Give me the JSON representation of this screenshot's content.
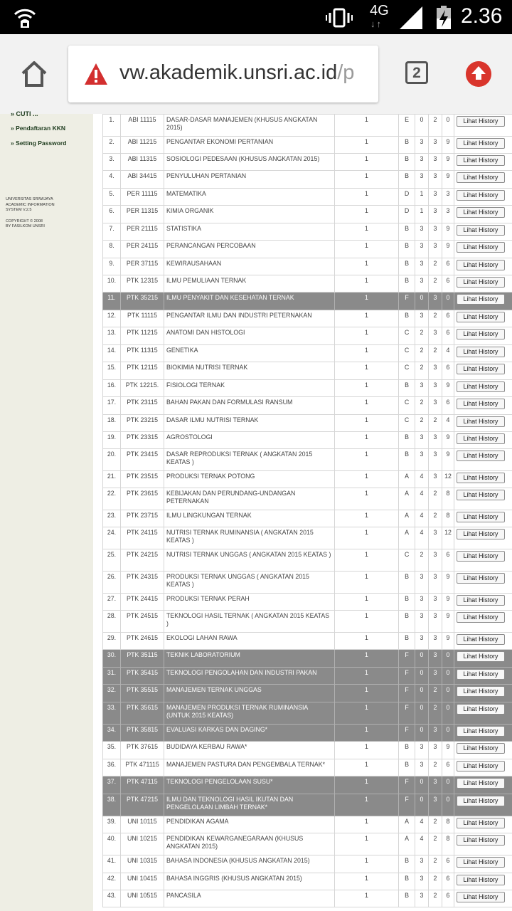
{
  "status_bar": {
    "network": "4G",
    "time": "2.36",
    "icons": [
      "wifi-hotspot-icon",
      "vibrate-icon",
      "signal-icon",
      "battery-charging-icon"
    ]
  },
  "browser": {
    "url_main": "vw.akademik.unsri.ac.id",
    "url_rest": "/p",
    "tab_count": "2",
    "icons": [
      "home-icon",
      "warning-icon",
      "tabs-icon",
      "update-icon"
    ]
  },
  "sidebar": {
    "cut_item": "» CUTI ...",
    "links": [
      "» Pendaftaran KKN",
      "» Setting Password"
    ],
    "footer": [
      "UNIVERSITAS SRIWIJAYA",
      "ACADEMIC INFORMATION",
      "SYSTEM V.2.5",
      "",
      "COPYRIGHT © 2008",
      "BY FASILKOM UNSRI"
    ]
  },
  "table": {
    "button_label": "Lihat History",
    "rows": [
      {
        "no": "1.",
        "code": "ABI 11115",
        "name": "DASAR-DASAR MANAJEMEN (KHUSUS ANGKATAN 2015)",
        "sem": "1",
        "grade": "E",
        "a": "0",
        "b": "2",
        "c": "0",
        "fail": false
      },
      {
        "no": "2.",
        "code": "ABI 11215",
        "name": "PENGANTAR EKONOMI PERTANIAN",
        "sem": "1",
        "grade": "B",
        "a": "3",
        "b": "3",
        "c": "9",
        "fail": false
      },
      {
        "no": "3.",
        "code": "ABI 11315",
        "name": "SOSIOLOGI PEDESAAN (KHUSUS ANGKATAN 2015)",
        "sem": "1",
        "grade": "B",
        "a": "3",
        "b": "3",
        "c": "9",
        "fail": false
      },
      {
        "no": "4.",
        "code": "ABI 34415",
        "name": "PENYULUHAN PERTANIAN",
        "sem": "1",
        "grade": "B",
        "a": "3",
        "b": "3",
        "c": "9",
        "fail": false
      },
      {
        "no": "5.",
        "code": "PER 11115",
        "name": "MATEMATIKA",
        "sem": "1",
        "grade": "D",
        "a": "1",
        "b": "3",
        "c": "3",
        "fail": false
      },
      {
        "no": "6.",
        "code": "PER 11315",
        "name": "KIMIA ORGANIK",
        "sem": "1",
        "grade": "D",
        "a": "1",
        "b": "3",
        "c": "3",
        "fail": false
      },
      {
        "no": "7.",
        "code": "PER 21115",
        "name": "STATISTIKA",
        "sem": "1",
        "grade": "B",
        "a": "3",
        "b": "3",
        "c": "9",
        "fail": false
      },
      {
        "no": "8.",
        "code": "PER 24115",
        "name": "PERANCANGAN PERCOBAAN",
        "sem": "1",
        "grade": "B",
        "a": "3",
        "b": "3",
        "c": "9",
        "fail": false
      },
      {
        "no": "9.",
        "code": "PER 37115",
        "name": "KEWIRAUSAHAAN",
        "sem": "1",
        "grade": "B",
        "a": "3",
        "b": "2",
        "c": "6",
        "fail": false
      },
      {
        "no": "10.",
        "code": "PTK  12315",
        "name": "ILMU PEMULIAAN TERNAK",
        "sem": "1",
        "grade": "B",
        "a": "3",
        "b": "2",
        "c": "6",
        "fail": false
      },
      {
        "no": "11.",
        "code": "PTK  35215",
        "name": "ILMU PENYAKIT DAN KESEHATAN TERNAK",
        "sem": "1",
        "grade": "F",
        "a": "0",
        "b": "3",
        "c": "0",
        "fail": true
      },
      {
        "no": "12.",
        "code": "PTK 11115",
        "name": "PENGANTAR ILMU DAN INDUSTRI PETERNAKAN",
        "sem": "1",
        "grade": "B",
        "a": "3",
        "b": "2",
        "c": "6",
        "fail": false
      },
      {
        "no": "13.",
        "code": "PTK 11215",
        "name": "ANATOMI DAN HISTOLOGI",
        "sem": "1",
        "grade": "C",
        "a": "2",
        "b": "3",
        "c": "6",
        "fail": false
      },
      {
        "no": "14.",
        "code": "PTK 11315",
        "name": "GENETIKA",
        "sem": "1",
        "grade": "C",
        "a": "2",
        "b": "2",
        "c": "4",
        "fail": false
      },
      {
        "no": "15.",
        "code": "PTK 12115",
        "name": "BIOKIMIA NUTRISI TERNAK",
        "sem": "1",
        "grade": "C",
        "a": "2",
        "b": "3",
        "c": "6",
        "fail": false
      },
      {
        "no": "16.",
        "code": "PTK 12215.",
        "name": "FISIOLOGI TERNAK",
        "sem": "1",
        "grade": "B",
        "a": "3",
        "b": "3",
        "c": "9",
        "fail": false
      },
      {
        "no": "17.",
        "code": "PTK 23115",
        "name": "BAHAN PAKAN DAN FORMULASI RANSUM",
        "sem": "1",
        "grade": "C",
        "a": "2",
        "b": "3",
        "c": "6",
        "fail": false
      },
      {
        "no": "18.",
        "code": "PTK 23215",
        "name": "DASAR ILMU NUTRISI TERNAK",
        "sem": "1",
        "grade": "C",
        "a": "2",
        "b": "2",
        "c": "4",
        "fail": false
      },
      {
        "no": "19.",
        "code": "PTK 23315",
        "name": "AGROSTOLOGI",
        "sem": "1",
        "grade": "B",
        "a": "3",
        "b": "3",
        "c": "9",
        "fail": false
      },
      {
        "no": "20.",
        "code": "PTK 23415",
        "name": "DASAR REPRODUKSI TERNAK ( ANGKATAN 2015 KEATAS )",
        "sem": "1",
        "grade": "B",
        "a": "3",
        "b": "3",
        "c": "9",
        "fail": false
      },
      {
        "no": "21.",
        "code": "PTK 23515",
        "name": "PRODUKSI TERNAK POTONG",
        "sem": "1",
        "grade": "A",
        "a": "4",
        "b": "3",
        "c": "12",
        "fail": false
      },
      {
        "no": "22.",
        "code": "PTK 23615",
        "name": "KEBIJAKAN DAN PERUNDANG-UNDANGAN PETERNAKAN",
        "sem": "1",
        "grade": "A",
        "a": "4",
        "b": "2",
        "c": "8",
        "fail": false
      },
      {
        "no": "23.",
        "code": "PTK 23715",
        "name": "ILMU LINGKUNGAN TERNAK",
        "sem": "1",
        "grade": "A",
        "a": "4",
        "b": "2",
        "c": "8",
        "fail": false
      },
      {
        "no": "24.",
        "code": "PTK 24115",
        "name": "NUTRISI TERNAK RUMINANSIA ( ANGKATAN 2015 KEATAS )",
        "sem": "1",
        "grade": "A",
        "a": "4",
        "b": "3",
        "c": "12",
        "fail": false
      },
      {
        "no": "25.",
        "code": "PTK 24215",
        "name": "NUTRISI TERNAK UNGGAS ( ANGKATAN 2015 KEATAS )",
        "sem": "1",
        "grade": "C",
        "a": "2",
        "b": "3",
        "c": "6",
        "fail": false
      },
      {
        "no": "26.",
        "code": "PTK 24315",
        "name": "PRODUKSI TERNAK UNGGAS ( ANGKATAN 2015 KEATAS )",
        "sem": "1",
        "grade": "B",
        "a": "3",
        "b": "3",
        "c": "9",
        "fail": false
      },
      {
        "no": "27.",
        "code": "PTK 24415",
        "name": "PRODUKSI TERNAK PERAH",
        "sem": "1",
        "grade": "B",
        "a": "3",
        "b": "3",
        "c": "9",
        "fail": false
      },
      {
        "no": "28.",
        "code": "PTK 24515",
        "name": "TEKNOLOGI HASIL TERNAK ( ANGKATAN 2015 KEATAS )",
        "sem": "1",
        "grade": "B",
        "a": "3",
        "b": "3",
        "c": "9",
        "fail": false
      },
      {
        "no": "29.",
        "code": "PTK 24615",
        "name": "EKOLOGI LAHAN RAWA",
        "sem": "1",
        "grade": "B",
        "a": "3",
        "b": "3",
        "c": "9",
        "fail": false
      },
      {
        "no": "30.",
        "code": "PTK 35115",
        "name": "TEKNIK LABORATORIUM",
        "sem": "1",
        "grade": "F",
        "a": "0",
        "b": "3",
        "c": "0",
        "fail": true
      },
      {
        "no": "31.",
        "code": "PTK 35415",
        "name": "TEKNOLOGI PENGOLAHAN DAN INDUSTRI PAKAN",
        "sem": "1",
        "grade": "F",
        "a": "0",
        "b": "3",
        "c": "0",
        "fail": true
      },
      {
        "no": "32.",
        "code": "PTK 35515",
        "name": "MANAJEMEN TERNAK UNGGAS",
        "sem": "1",
        "grade": "F",
        "a": "0",
        "b": "2",
        "c": "0",
        "fail": true
      },
      {
        "no": "33.",
        "code": "PTK 35615",
        "name": "MANAJEMEN PRODUKSI TERNAK RUMINANSIA (UNTUK 2015 KEATAS)",
        "sem": "1",
        "grade": "F",
        "a": "0",
        "b": "2",
        "c": "0",
        "fail": true
      },
      {
        "no": "34.",
        "code": "PTK 35815",
        "name": "EVALUASI KARKAS DAN DAGING*",
        "sem": "1",
        "grade": "F",
        "a": "0",
        "b": "3",
        "c": "0",
        "fail": true
      },
      {
        "no": "35.",
        "code": "PTK 37615",
        "name": "BUDIDAYA KERBAU RAWA*",
        "sem": "1",
        "grade": "B",
        "a": "3",
        "b": "3",
        "c": "9",
        "fail": false
      },
      {
        "no": "36.",
        "code": "PTK 471115",
        "name": "MANAJEMEN PASTURA DAN PENGEMBALA TERNAK*",
        "sem": "1",
        "grade": "B",
        "a": "3",
        "b": "2",
        "c": "6",
        "fail": false
      },
      {
        "no": "37.",
        "code": "PTK 47115",
        "name": "TEKNOLOGI PENGELOLAAN SUSU*",
        "sem": "1",
        "grade": "F",
        "a": "0",
        "b": "3",
        "c": "0",
        "fail": true
      },
      {
        "no": "38.",
        "code": "PTK 47215",
        "name": "ILMU DAN TEKNOLOGI HASIL IKUTAN DAN PENGELOLAAN LIMBAH TERNAK*",
        "sem": "1",
        "grade": "F",
        "a": "0",
        "b": "3",
        "c": "0",
        "fail": true
      },
      {
        "no": "39.",
        "code": "UNI 10115",
        "name": "PENDIDIKAN AGAMA",
        "sem": "1",
        "grade": "A",
        "a": "4",
        "b": "2",
        "c": "8",
        "fail": false
      },
      {
        "no": "40.",
        "code": "UNI 10215",
        "name": "PENDIDIKAN KEWARGANEGARAAN (KHUSUS ANGKATAN 2015)",
        "sem": "1",
        "grade": "A",
        "a": "4",
        "b": "2",
        "c": "8",
        "fail": false
      },
      {
        "no": "41.",
        "code": "UNI 10315",
        "name": "BAHASA INDONESIA (KHUSUS ANGKATAN 2015)",
        "sem": "1",
        "grade": "B",
        "a": "3",
        "b": "2",
        "c": "6",
        "fail": false
      },
      {
        "no": "42.",
        "code": "UNI 10415",
        "name": "BAHASA INGGRIS (KHUSUS ANGKATAN 2015)",
        "sem": "1",
        "grade": "B",
        "a": "3",
        "b": "2",
        "c": "6",
        "fail": false
      },
      {
        "no": "43.",
        "code": "UNI 10515",
        "name": "PANCASILA",
        "sem": "1",
        "grade": "B",
        "a": "3",
        "b": "2",
        "c": "6",
        "fail": false
      }
    ]
  }
}
